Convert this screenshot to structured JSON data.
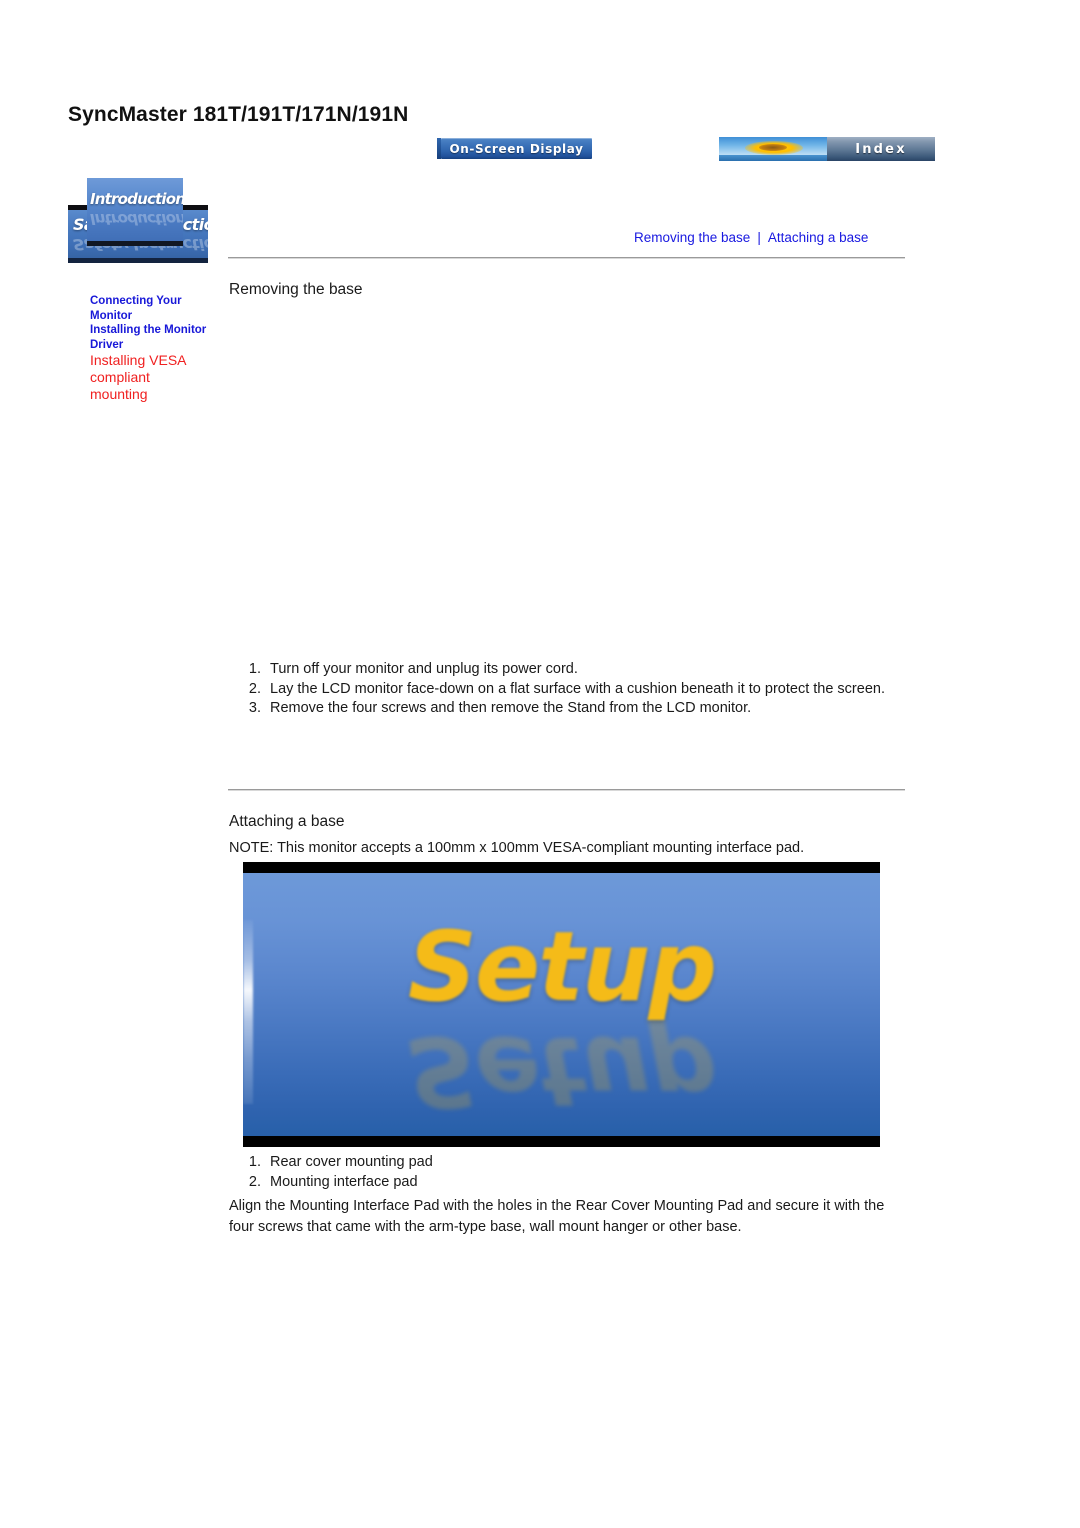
{
  "page": {
    "title": "SyncMaster 181T/191T/171N/191N"
  },
  "topnav": {
    "osd_button": "On-Screen Display",
    "index_button": "Index"
  },
  "sidebar": {
    "banners": [
      {
        "label": "Safety Instructions"
      },
      {
        "label": "Introduction"
      }
    ],
    "links": [
      {
        "label": "Connecting Your Monitor",
        "color": "#1818d8",
        "active": false
      },
      {
        "label": "Installing the Monitor Driver",
        "color": "#1818d8",
        "active": false
      },
      {
        "label": "Installing VESA compliant mounting",
        "color": "#f02020",
        "active": true
      }
    ]
  },
  "breadcrumb": {
    "first_link": "Removing the base",
    "separator": "|",
    "second_link": "Attaching a base"
  },
  "sections": {
    "removing": {
      "heading": "Removing the base",
      "steps": [
        {
          "num": "1.",
          "text": "Turn off your monitor and unplug its power cord."
        },
        {
          "num": "2.",
          "text": "Lay the LCD monitor face-down on a flat surface with a cushion beneath it to protect the screen."
        },
        {
          "num": "3.",
          "text": "Remove the four screws and then remove the Stand from the LCD monitor."
        }
      ]
    },
    "attaching": {
      "heading": "Attaching a base",
      "note": "NOTE: This monitor accepts a 100mm x 100mm VESA-compliant mounting interface pad.",
      "figure": {
        "caption_word": "Setup",
        "background_top_color": "#6d99d9",
        "background_bottom_color": "#2760a9",
        "text_color": "#f5bb18"
      },
      "items": [
        {
          "num": "1.",
          "text": "Rear cover mounting pad"
        },
        {
          "num": "2.",
          "text": "Mounting interface pad"
        }
      ],
      "closing": "Align the Mounting Interface Pad with the holes in the Rear Cover Mounting Pad and secure it with the four screws that came with the arm-type base, wall mount hanger or other base."
    }
  }
}
